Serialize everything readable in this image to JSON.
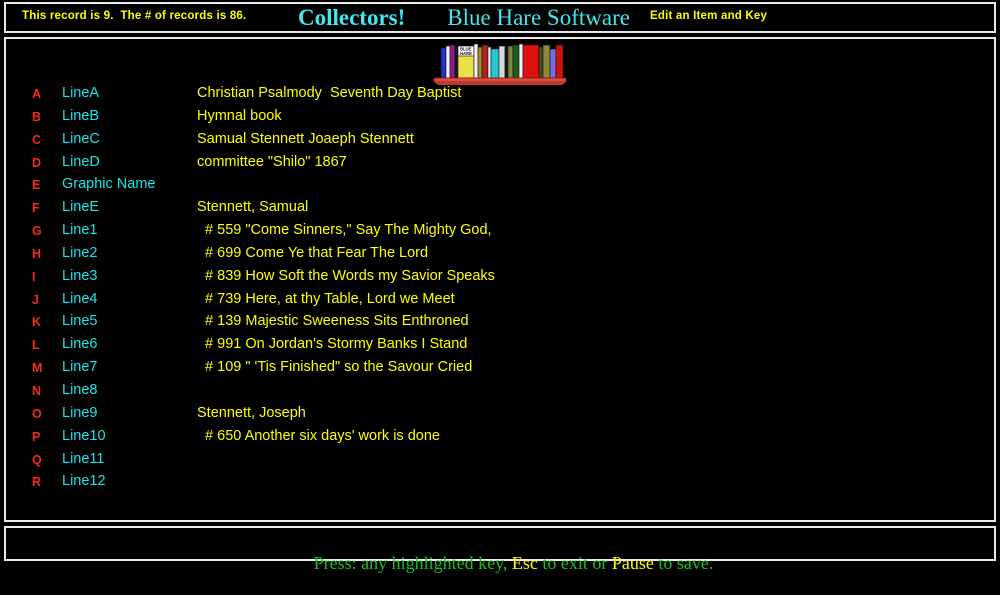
{
  "header": {
    "record_status": "This record is 9.  The # of records is 86.",
    "brand_primary": "Collectors!",
    "brand_secondary": "Blue Hare Software",
    "bunny_icon": "rabbit-icon",
    "mode_label": "Edit an Item and Key"
  },
  "graphic": {
    "name": "bookshelf-graphic",
    "book_label_line1": "BLUE",
    "book_label_line2": "HARE",
    "shelf_color": "#e04b3c",
    "book_colors": [
      "#2233cc",
      "#f2f2f2",
      "#8b1a8b",
      "#1a1a1a",
      "#e8e048",
      "#f2f2f2",
      "#9b8f2e",
      "#b02020",
      "#f2f2f2",
      "#20c8d8",
      "#d8d8d8",
      "#7a8a3a",
      "#1c5c1c",
      "#f2f2f2",
      "#e01010",
      "#4a4a2a",
      "#8a8a3a",
      "#7a6ae0",
      "#d01010"
    ]
  },
  "fields": [
    {
      "key": "A",
      "label": "LineA",
      "value": "Christian Psalmody  Seventh Day Baptist"
    },
    {
      "key": "B",
      "label": "LineB",
      "value": "Hymnal book"
    },
    {
      "key": "C",
      "label": "LineC",
      "value": "Samual Stennett Joaeph Stennett"
    },
    {
      "key": "D",
      "label": "LineD",
      "value": "committee \"Shilo\" 1867"
    },
    {
      "key": "E",
      "label": "Graphic Name",
      "value": ""
    },
    {
      "key": "F",
      "label": "LineE",
      "value": "Stennett, Samual"
    },
    {
      "key": "G",
      "label": "Line1",
      "value": "  # 559 \"Come Sinners,\" Say The Mighty God,"
    },
    {
      "key": "H",
      "label": "Line2",
      "value": "  # 699 Come Ye that Fear The Lord"
    },
    {
      "key": "I",
      "label": "Line3",
      "value": "  # 839 How Soft the Words my Savior Speaks"
    },
    {
      "key": "J",
      "label": "Line4",
      "value": "  # 739 Here, at thy Table, Lord we Meet"
    },
    {
      "key": "K",
      "label": "Line5",
      "value": "  # 139 Majestic Sweeness Sits Enthroned"
    },
    {
      "key": "L",
      "label": "Line6",
      "value": "  # 991 On Jordan's Stormy Banks I Stand"
    },
    {
      "key": "M",
      "label": "Line7",
      "value": "  # 109 \" 'Tis Finished\" so the Savour Cried"
    },
    {
      "key": "N",
      "label": "Line8",
      "value": ""
    },
    {
      "key": "O",
      "label": "Line9",
      "value": "Stennett, Joseph"
    },
    {
      "key": "P",
      "label": "Line10",
      "value": "  # 650 Another six days' work is done"
    },
    {
      "key": "Q",
      "label": "Line11",
      "value": ""
    },
    {
      "key": "R",
      "label": "Line12",
      "value": ""
    }
  ],
  "footer": {
    "part1": "Press: any highlighted key, ",
    "key1": "Esc",
    "part2": " to exit or ",
    "key2": "Pause",
    "part3": " to save."
  },
  "colors": {
    "background": "#000000",
    "border": "#e8e8e8",
    "key_letter": "#f02b17",
    "field_label": "#12e8e8",
    "field_value": "#ffff00",
    "brand": "#3fe9ef",
    "status_text": "#ffff00",
    "footer_text": "#18c018",
    "footer_highlight": "#ffff00"
  }
}
